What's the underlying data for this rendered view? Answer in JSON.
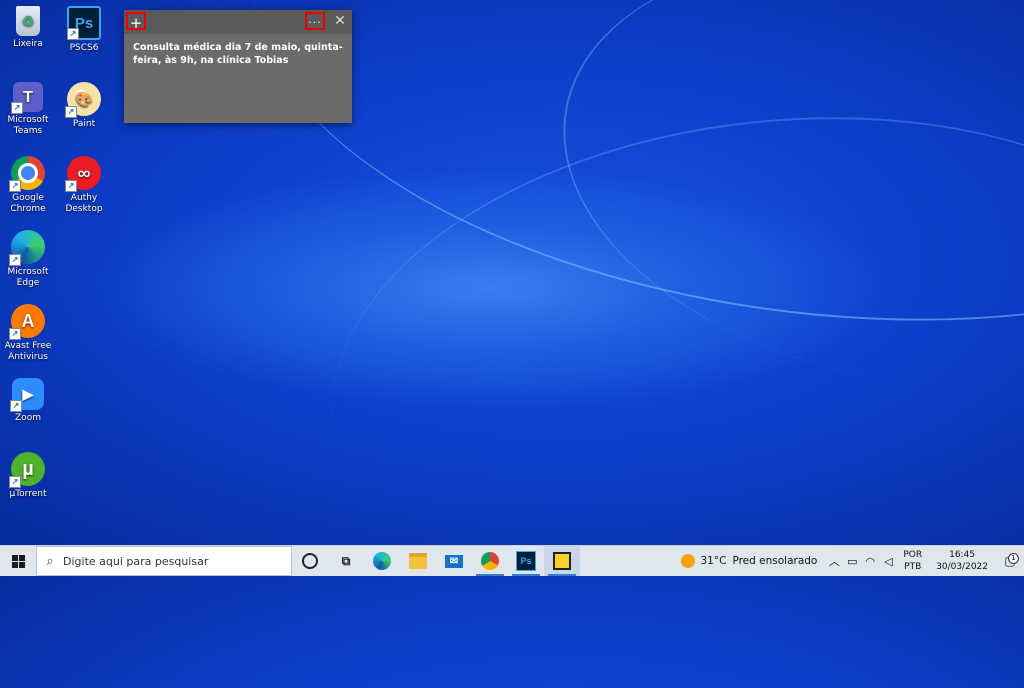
{
  "desktop": {
    "icons": [
      {
        "label": "Lixeira",
        "glyph": "♻"
      },
      {
        "label": "PSCS6",
        "glyph": "Ps"
      },
      {
        "label": "Microsoft Teams",
        "glyph": "T"
      },
      {
        "label": "Paint",
        "glyph": "🎨"
      },
      {
        "label": "Google Chrome",
        "glyph": ""
      },
      {
        "label": "Authy Desktop",
        "glyph": "∞"
      },
      {
        "label": "Microsoft Edge",
        "glyph": ""
      },
      {
        "label": "Avast Free Antivirus",
        "glyph": "A"
      },
      {
        "label": "Zoom",
        "glyph": "▶"
      },
      {
        "label": "µTorrent",
        "glyph": "µ"
      }
    ]
  },
  "sticky_note": {
    "add_glyph": "+",
    "menu_glyph": "···",
    "close_glyph": "✕",
    "text": "Consulta médica dia 7 de maio, quinta-feira, às 9h, na clínica Tobias"
  },
  "taskbar": {
    "search_placeholder": "Digite aqui para pesquisar",
    "weather_temp": "31°C",
    "weather_text": "Pred ensolarado",
    "lang_top": "POR",
    "lang_bottom": "PTB",
    "time": "16:45",
    "date": "30/03/2022",
    "notification_count": "1"
  },
  "colors": {
    "accent": "#3a78d6",
    "sticky_highlight": "#e00000"
  }
}
